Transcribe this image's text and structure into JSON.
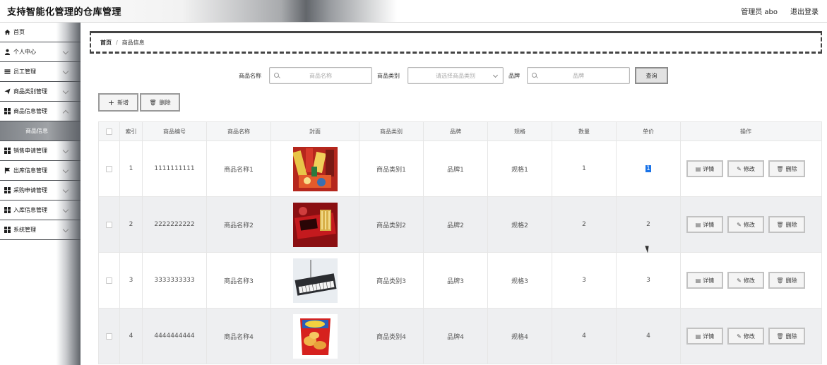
{
  "header": {
    "title": "支持智能化管理的仓库管理",
    "user": "管理员 abo",
    "logout": "退出登录"
  },
  "sidebar": {
    "items": [
      {
        "label": "首页",
        "icon": "home-icon",
        "chevron": false
      },
      {
        "label": "个人中心",
        "icon": "user-icon",
        "chevron": true
      },
      {
        "label": "员工管理",
        "icon": "list-icon",
        "chevron": true
      },
      {
        "label": "商品类别管理",
        "icon": "send-icon",
        "chevron": true
      },
      {
        "label": "商品信息管理",
        "icon": "grid-icon",
        "chevron": true
      }
    ],
    "sub_item": "商品信息",
    "items2": [
      {
        "label": "销售申请管理",
        "icon": "grid-icon"
      },
      {
        "label": "出库信息管理",
        "icon": "flag-icon"
      },
      {
        "label": "采购申请管理",
        "icon": "grid-icon"
      },
      {
        "label": "入库信息管理",
        "icon": "grid-icon"
      },
      {
        "label": "系统管理",
        "icon": "grid-icon"
      }
    ]
  },
  "breadcrumb": {
    "home": "首页",
    "separator": "/",
    "current": "商品信息"
  },
  "search": {
    "name_label": "商品名称",
    "name_placeholder": "商品名称",
    "category_label": "商品类别",
    "category_placeholder": "请选择商品类别",
    "brand_label": "品牌",
    "brand_placeholder": "品牌",
    "query": "查询"
  },
  "actions": {
    "add": "新增",
    "delete": "删除"
  },
  "table": {
    "headers": [
      "索引",
      "商品编号",
      "商品名称",
      "封面",
      "商品类别",
      "品牌",
      "规格",
      "数量",
      "单价",
      "操作"
    ],
    "rows": [
      {
        "index": "1",
        "code": "1111111111",
        "name": "商品名称1",
        "cover": "festive-goods",
        "category": "商品类别1",
        "brand": "品牌1",
        "spec": "规格1",
        "qty": "1",
        "price": "1"
      },
      {
        "index": "2",
        "code": "2222222222",
        "name": "商品名称2",
        "cover": "red-gift-box",
        "category": "商品类别2",
        "brand": "品牌2",
        "spec": "规格2",
        "qty": "2",
        "price": "2"
      },
      {
        "index": "3",
        "code": "3333333333",
        "name": "商品名称3",
        "cover": "electronic-keyboard",
        "category": "商品类别3",
        "brand": "品牌3",
        "spec": "规格3",
        "qty": "3",
        "price": "3"
      },
      {
        "index": "4",
        "code": "4444444444",
        "name": "商品名称4",
        "cover": "chips-bag",
        "category": "商品类别4",
        "brand": "品牌4",
        "spec": "规格4",
        "qty": "4",
        "price": "4"
      }
    ],
    "op_detail": "详情",
    "op_edit": "修改",
    "op_delete": "删除"
  }
}
